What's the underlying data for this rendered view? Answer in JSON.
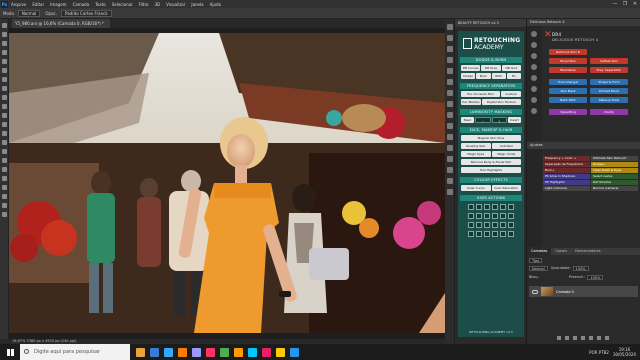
{
  "menubar": {
    "app_icon": "Ps",
    "items": [
      "Arquivo",
      "Editar",
      "Imagem",
      "Camada",
      "Texto",
      "Selecionar",
      "Filtro",
      "3D",
      "Visualizar",
      "Janela",
      "Ajuda"
    ],
    "window_controls": [
      "—",
      "❐",
      "✕"
    ]
  },
  "options_bar": {
    "mode_label": "Modo",
    "mode_value": "Normal",
    "opacity_label": "Opac.",
    "sample_value": "Padrão Cortex Franck"
  },
  "document": {
    "tab_title": "Y5_980.ani @ 16,6% (Camada 0, RGB/16*) *",
    "status": "16,67%     7380 px x 4920 px (240 ppi)"
  },
  "retouching_panel": {
    "header": "BEAUTY RETOUCH v4.3",
    "brand_line1": "RETOUCHING",
    "brand_line2": "ACADEMY",
    "sections": [
      {
        "title": "DODGE & BURN",
        "rows": [
          [
            "DB Curves",
            "DB Grey",
            "DB Grid"
          ],
          [
            "Dodge",
            "Burn",
            "Rfsh",
            "Fix"
          ]
        ]
      },
      {
        "title": "FREQUENCY SEPARATION",
        "rows": [
          [
            "Hsc Occasion Blur",
            "Custom"
          ],
          [
            "Hsc Median",
            "Digital Skin Texture"
          ]
        ]
      },
      {
        "title": "LUMINOSITY MASKING",
        "rows": [
          [
            "Basic",
            "−",
            "+",
            "Invert"
          ]
        ]
      },
      {
        "title": "FACE, MAKEUP & HAIR",
        "rows": [
          [
            "Magical Skin Tone"
          ],
          [
            "Glowing Skin",
            "Anti-Red"
          ],
          [
            "Magic Eyes",
            "Magic Smile"
          ],
          [
            "Remove Body & Facial Hair"
          ],
          [
            "Hair Highlights"
          ]
        ]
      },
      {
        "title": "COLOUR EFFECTS",
        "rows": [
          [
            "Solar Curve",
            "Gren Saturation"
          ]
        ]
      },
      {
        "title": "USER ACTIONS",
        "rows": []
      }
    ],
    "version": "RETOUCHING ACADEMY v4.3"
  },
  "deluxe_panel": {
    "header": "Delicious Retouch 4",
    "title_line1": "DR4",
    "title_line2": "DELICIOUS RETOUCH 4",
    "buttons": [
      {
        "label": "Delicious Skin #",
        "color": "#c0392b"
      },
      {
        "label": "Facial Skin",
        "color": "#c0392b"
      },
      {
        "label": "Softest Skin",
        "color": "#c0392b"
      },
      {
        "label": "Blemishes",
        "color": "#c0392b"
      },
      {
        "label": "Freq. Separation",
        "color": "#c0392b"
      },
      {
        "label": "Tone Changer",
        "color": "#2e6fb0"
      },
      {
        "label": "Shape & Form",
        "color": "#2e6fb0"
      },
      {
        "label": "Skin Mask",
        "color": "#2e6fb0"
      },
      {
        "label": "Portrait Mood",
        "color": "#2e6fb0"
      },
      {
        "label": "Teeth Whit.",
        "color": "#2e6fb0"
      },
      {
        "label": "Makeup Tools",
        "color": "#2e6fb0"
      },
      {
        "label": "Vignetting",
        "color": "#8e3aa8"
      },
      {
        "label": "Clarity",
        "color": "#8e3aa8"
      }
    ]
  },
  "adjustments_panel": {
    "header": "Ajustes",
    "cells": [
      {
        "label": "Frequency + Color +",
        "color": "#6a2a2a"
      },
      {
        "label": "Ultimate Skin Retouch",
        "color": "#444444"
      },
      {
        "label": "Separação de Frequência",
        "color": "#6a2a2a"
      },
      {
        "label": "Dodge+",
        "color": "#b08a10"
      },
      {
        "label": "Burn+",
        "color": "#6a2a2a"
      },
      {
        "label": "Clear Teeth & Eyes",
        "color": "#b08a10"
      },
      {
        "label": "PS Glow in Shadows",
        "color": "#3f3a8a"
      },
      {
        "label": "Select realce",
        "color": "#2e5a30"
      },
      {
        "label": "PS Highlights",
        "color": "#3f3a8a"
      },
      {
        "label": "Def Shadow",
        "color": "#2e5a30"
      },
      {
        "label": "Light (camera)",
        "color": "#444444"
      },
      {
        "label": "Normal (camera)",
        "color": "#444444"
      }
    ]
  },
  "layers_panel": {
    "tabs": [
      "Camadas",
      "Canais",
      "Demarcadores"
    ],
    "filter_label": "Tipo",
    "blend_mode": "Normal",
    "opacity_label": "Opacidade:",
    "opacity_value": "100%",
    "lock_label": "Bloq.:",
    "fill_label": "Preench.:",
    "fill_value": "100%",
    "layer_name": "Camada 0"
  },
  "taskbar": {
    "search_placeholder": "Digite aqui para pesquisar",
    "language": "POR PTB2",
    "time": "19:16",
    "date": "30/05/2020",
    "app_colors": [
      "#e8a33d",
      "#3a7bd5",
      "#31a8ff",
      "#ff7c00",
      "#9999ff",
      "#ff3366",
      "#4caf50",
      "#ff9a00",
      "#00c8ff",
      "#e91e63",
      "#ffcc00",
      "#2196f3"
    ]
  }
}
